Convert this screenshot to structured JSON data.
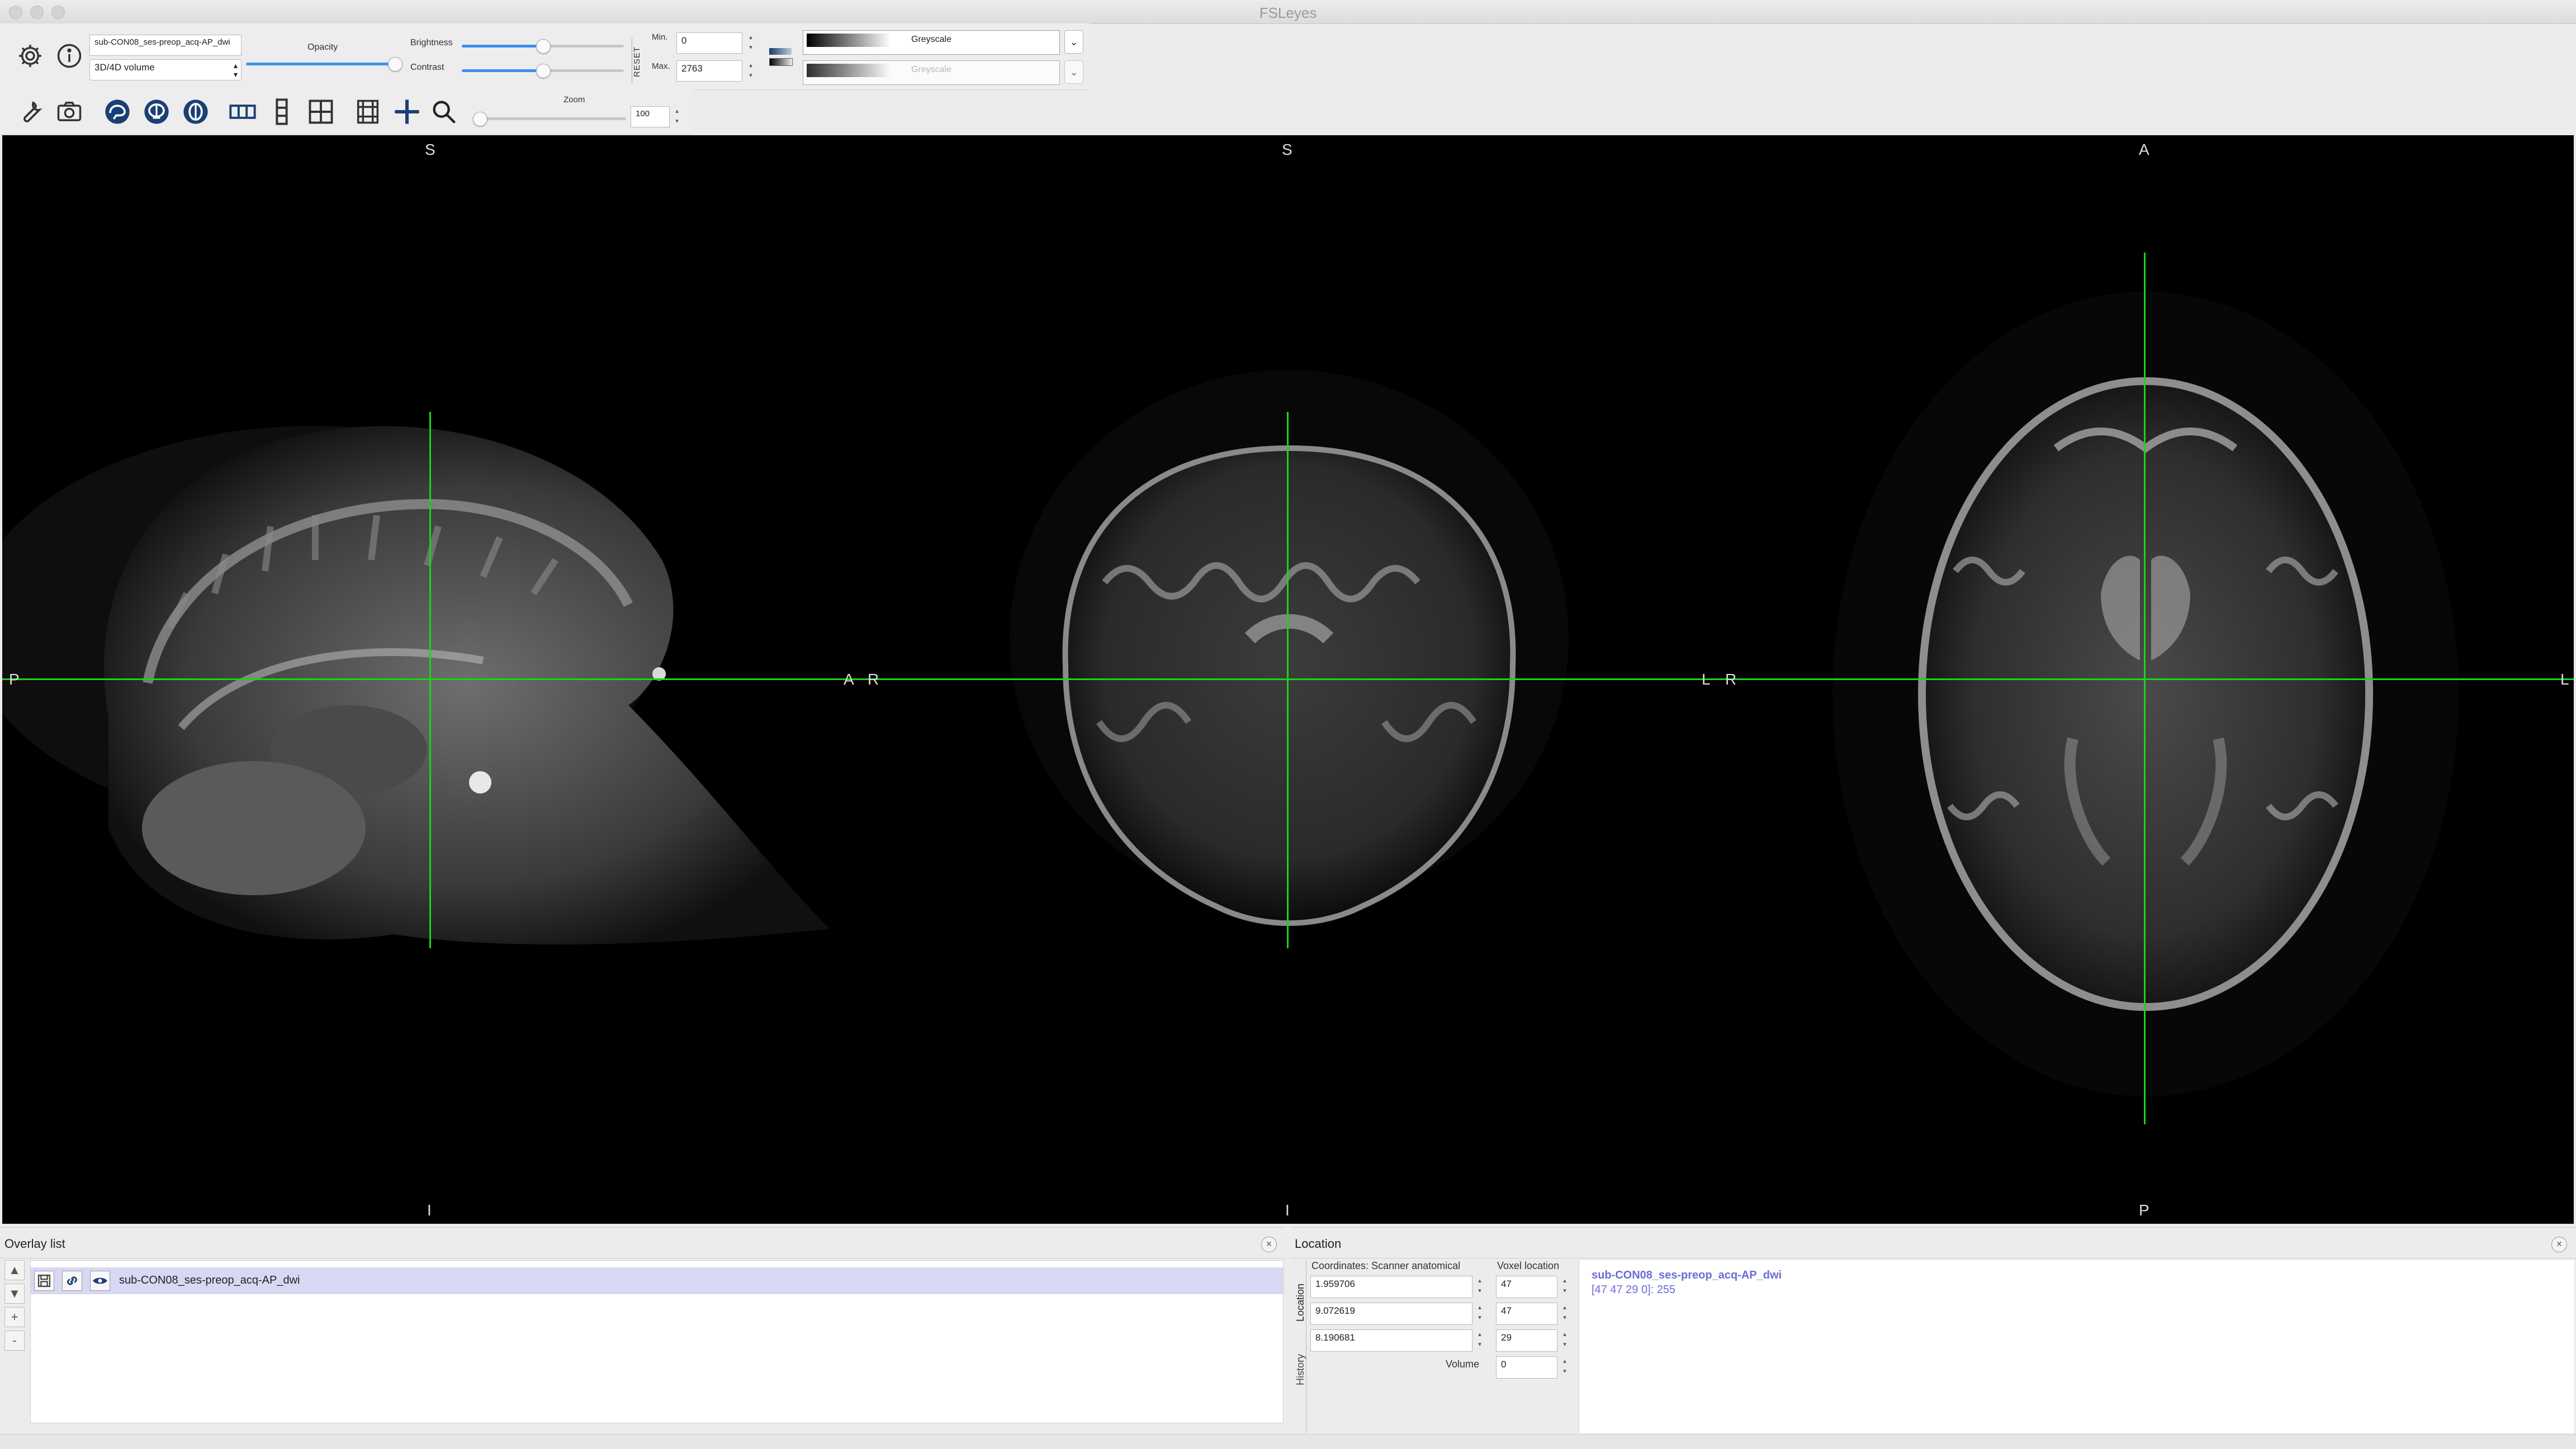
{
  "window": {
    "title": "FSLeyes"
  },
  "toolbar": {
    "overlay_name": "sub-CON08_ses-preop_acq-AP_dwi",
    "overlay_type": "3D/4D volume",
    "opacity_label": "Opacity",
    "opacity_value": 0.95,
    "brightness_label": "Brightness",
    "brightness_value": 0.5,
    "contrast_label": "Contrast",
    "contrast_value": 0.5,
    "reset_label": "RESET",
    "min_label": "Min.",
    "min_value": "0",
    "max_label": "Max.",
    "max_value": "2763",
    "cmap_primary": "Greyscale",
    "cmap_secondary": "Greyscale",
    "zoom_label": "Zoom",
    "zoom_value": "100"
  },
  "canvas": {
    "crosshair_color": "#1ed21e",
    "sagittal": {
      "top": "S",
      "bottom": "I",
      "left": "P",
      "right": "A"
    },
    "coronal": {
      "top": "S",
      "bottom": "I",
      "left": "R",
      "right": "L"
    },
    "axial": {
      "top": "A",
      "bottom": "P",
      "left": "R",
      "right": "L"
    }
  },
  "overlay_list": {
    "title": "Overlay list",
    "items": [
      {
        "name": "sub-CON08_ses-preop_acq-AP_dwi",
        "selected": true
      }
    ],
    "buttons": {
      "up": "▲",
      "down": "▼",
      "add": "+",
      "remove": "-"
    },
    "selection_color": "#d8d8f4"
  },
  "location": {
    "title": "Location",
    "tabs": [
      "Location",
      "History"
    ],
    "coords_header": "Coordinates: Scanner anatomical",
    "voxel_header": "Voxel location",
    "coords": [
      "1.959706",
      "9.072619",
      "8.190681"
    ],
    "voxels": [
      "47",
      "47",
      "29"
    ],
    "volume_label": "Volume",
    "volume_value": "0",
    "info_name": "sub-CON08_ses-preop_acq-AP_dwi",
    "info_value": "[47 47 29 0]: 255",
    "info_color": "#6b6bd6"
  }
}
